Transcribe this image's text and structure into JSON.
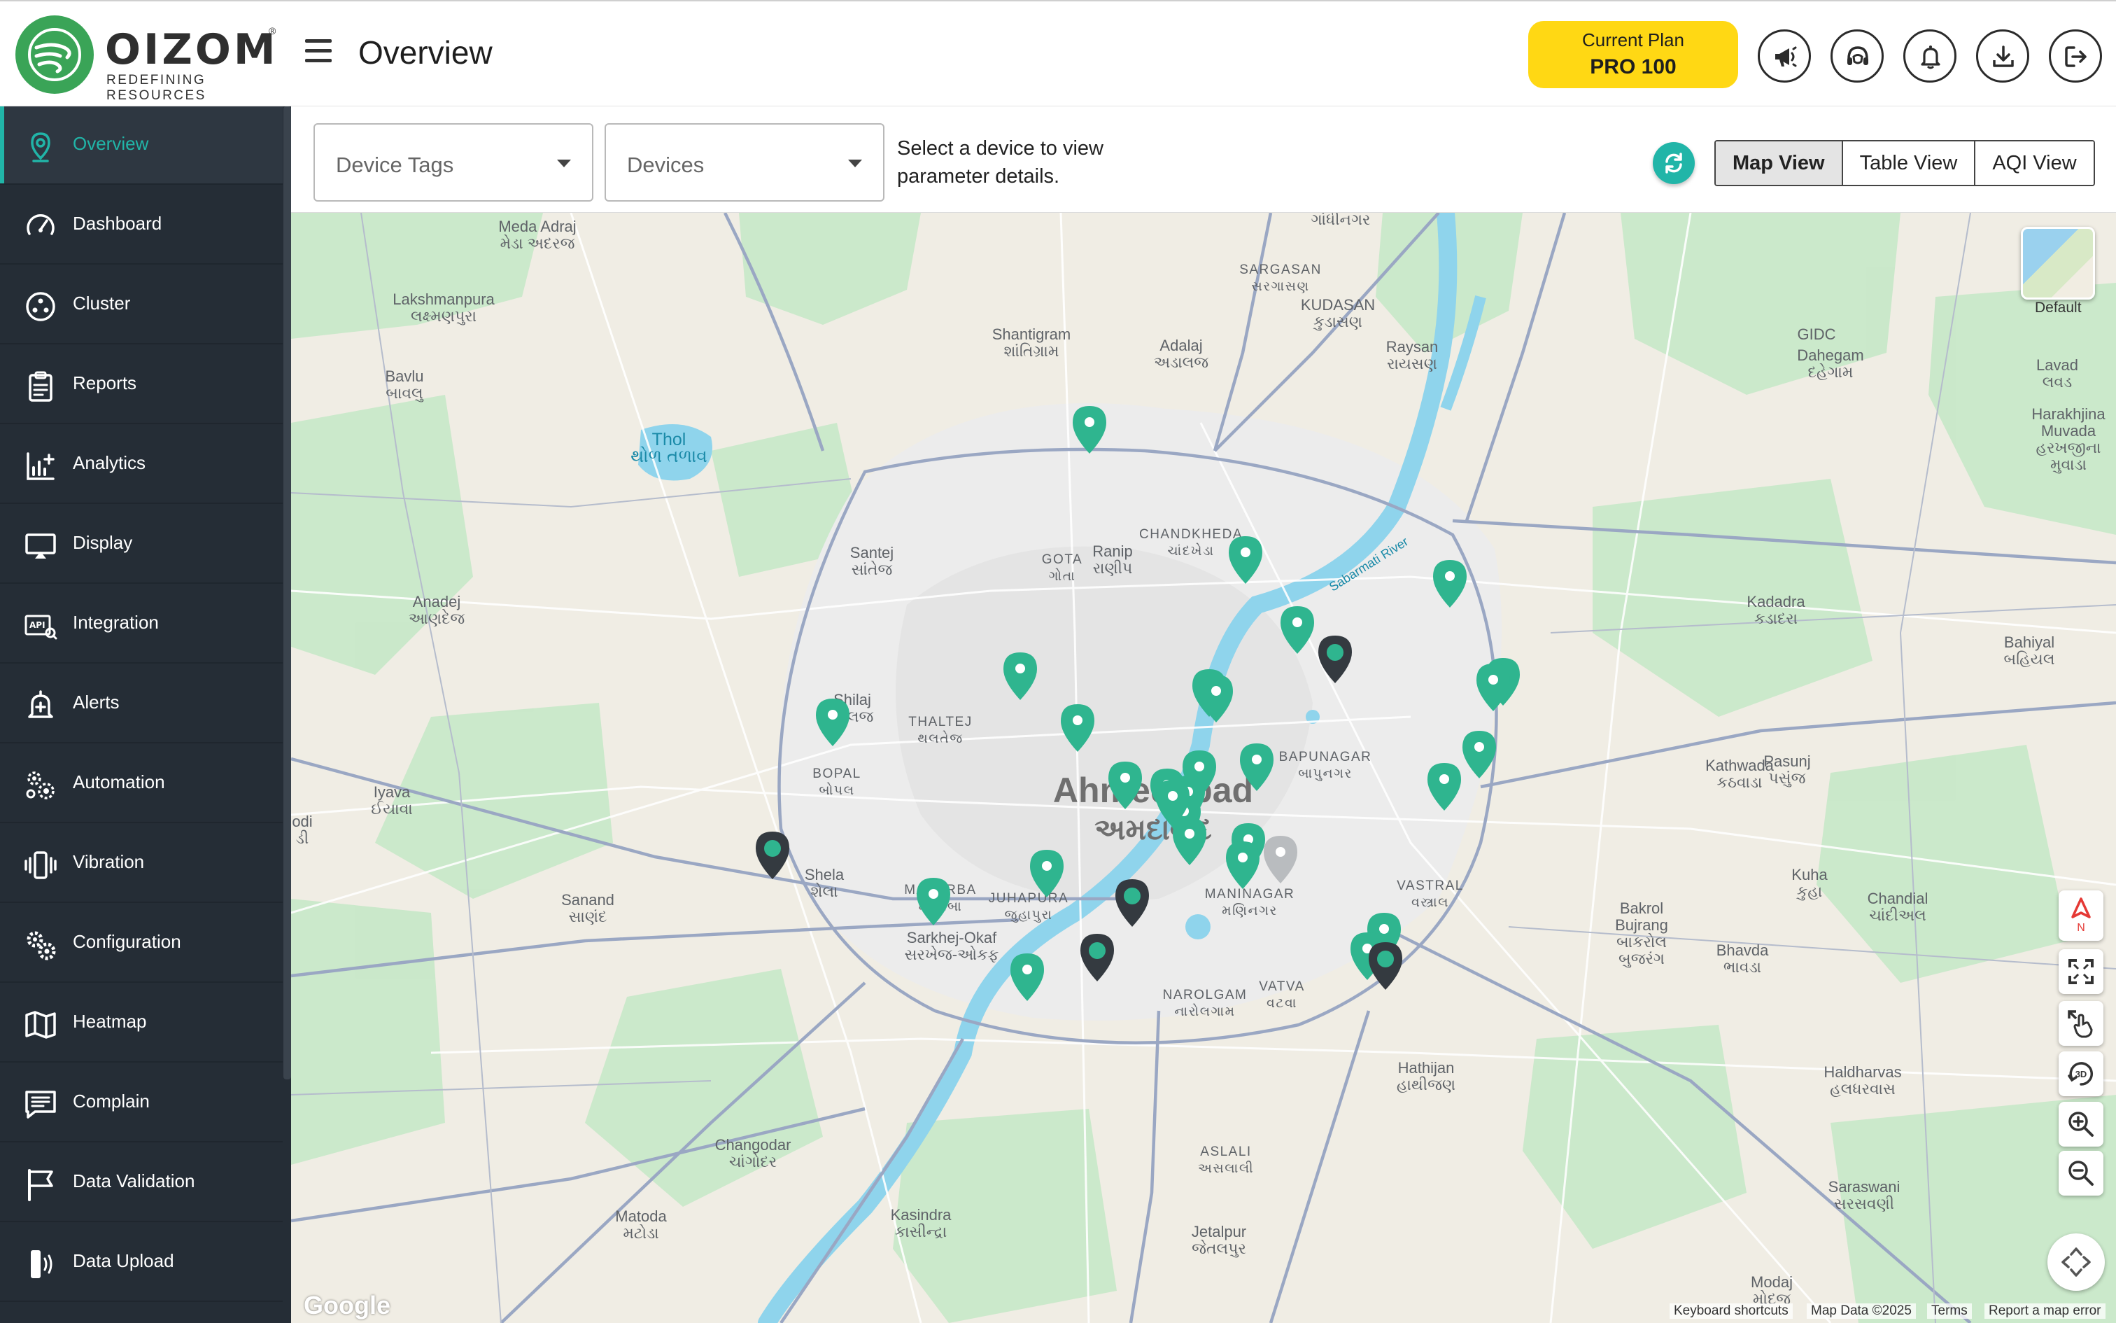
{
  "brand": {
    "name": "OIZOM",
    "tagline": "REDEFINING RESOURCES",
    "registered": "®",
    "color": "#3aa457"
  },
  "header": {
    "title": "Overview",
    "plan": {
      "label": "Current Plan",
      "value": "PRO 100",
      "color": "#ffd814"
    },
    "icons": [
      "megaphone-icon",
      "support-headset-icon",
      "bell-icon",
      "download-icon",
      "logout-icon"
    ]
  },
  "sidebar": {
    "accent": "#21b5a8",
    "items": [
      {
        "label": "Overview",
        "icon": "location-pin-icon",
        "active": true
      },
      {
        "label": "Dashboard",
        "icon": "gauge-icon"
      },
      {
        "label": "Cluster",
        "icon": "cluster-icon"
      },
      {
        "label": "Reports",
        "icon": "clipboard-icon"
      },
      {
        "label": "Analytics",
        "icon": "analytics-chart-icon"
      },
      {
        "label": "Display",
        "icon": "display-monitor-icon"
      },
      {
        "label": "Integration",
        "icon": "api-icon"
      },
      {
        "label": "Alerts",
        "icon": "alert-bell-icon"
      },
      {
        "label": "Automation",
        "icon": "automation-gears-icon"
      },
      {
        "label": "Vibration",
        "icon": "vibration-icon"
      },
      {
        "label": "Configuration",
        "icon": "gears-icon"
      },
      {
        "label": "Heatmap",
        "icon": "map-fold-icon"
      },
      {
        "label": "Complain",
        "icon": "comment-list-icon"
      },
      {
        "label": "Data Validation",
        "icon": "flag-icon"
      },
      {
        "label": "Data Upload",
        "icon": "upload-device-icon"
      }
    ]
  },
  "toolbar": {
    "device_tags": {
      "placeholder": "Device Tags"
    },
    "devices": {
      "placeholder": "Devices"
    },
    "hint": "Select a device to view parameter details.",
    "views": [
      {
        "label": "Map View",
        "active": true
      },
      {
        "label": "Table View",
        "active": false
      },
      {
        "label": "AQI View",
        "active": false
      }
    ]
  },
  "map": {
    "layer_label": "Default",
    "attribution": {
      "google": "Google",
      "shortcuts": "Keyboard shortcuts",
      "data": "Map Data ©2025",
      "terms": "Terms",
      "report": "Report a map error"
    },
    "compass": "N",
    "pin_colors": {
      "online": "#2fb58f",
      "offline": "#343a40",
      "inactive": "#b9bcbf"
    },
    "labels": [
      {
        "text": "Meda Adraj\nમેડા અદરજ"
      },
      {
        "text": "ગાંધીનગર"
      },
      {
        "text": "SARGASAN\nસરગાસણ"
      },
      {
        "text": "KUDASAN\nકુડાસણ"
      },
      {
        "text": "Raysan\nરાયસણ"
      },
      {
        "text": "GIDC"
      },
      {
        "text": "Dahegam\nદહેગામ"
      },
      {
        "text": "Lakshmanpura\nલક્ષ્મણપુરા"
      },
      {
        "text": "Bavlu\nબાવલુ"
      },
      {
        "text": "Shantigram\nશાંતિગ્રામ"
      },
      {
        "text": "Adalaj\nઅડાલજ"
      },
      {
        "text": "Lavad\nલવડ"
      },
      {
        "text": "Harakhjina\nMuvada\nહરખજીના\nમુવાડા"
      },
      {
        "text": "Thol\nથોળ તળાવ"
      },
      {
        "text": "CHANDKHEDA\nચાંદખેડા"
      },
      {
        "text": "Ranip\nરાણીપ"
      },
      {
        "text": "GOTA\nગોતા"
      },
      {
        "text": "Santej\nસાંતેજ"
      },
      {
        "text": "Sabarmati River"
      },
      {
        "text": "Anadej\nઆણદેજ"
      },
      {
        "text": "Kadadra\nકડાદરા"
      },
      {
        "text": "Bahiyal\nબહિયલ"
      },
      {
        "text": "Shilaj\nશીલજ"
      },
      {
        "text": "THALTEJ\nથલતેજ"
      },
      {
        "text": "Ahmedabad"
      },
      {
        "text": "અમદાવાદ"
      },
      {
        "text": "BAPUNAGAR\nબાપુનગર"
      },
      {
        "text": "Kathwada\nકઠવાડા"
      },
      {
        "text": "Pasunj\nપસુંજ"
      },
      {
        "text": "Iyava\nઈયાવા"
      },
      {
        "text": "BOPAL\nબોપલ"
      },
      {
        "text": "Shela\nશેલા"
      },
      {
        "text": "Sanand\nસાણંદ"
      },
      {
        "text": "MAKARBA\nમકરબા"
      },
      {
        "text": "JUHAPURA\nજુહાપુરા"
      },
      {
        "text": "MANINAGAR\nમણિનગર"
      },
      {
        "text": "VASTRAL\nવસ્ત્રાલ"
      },
      {
        "text": "Kuha\nકુહા"
      },
      {
        "text": "Chandial\nચાંદીઅલ"
      },
      {
        "text": "Bakrol\nBujrang\nબાકરોલ\nબુજરંગ"
      },
      {
        "text": "Bhavda\nભાવડા"
      },
      {
        "text": "Sarkhej-Okaf\nસરખેજ-ઓકફ"
      },
      {
        "text": "NAROLGAM\nનારોલગામ"
      },
      {
        "text": "VATVA\nવટવા"
      },
      {
        "text": "Hathijan\nહાથીજણ"
      },
      {
        "text": "Changodar\nચાંગોદર"
      },
      {
        "text": "ASLALI\nઅસલાલી"
      },
      {
        "text": "Matoda\nમટોડા"
      },
      {
        "text": "Kasindra\nકાસીન્દ્રા"
      },
      {
        "text": "Jetalpur\nજેતલપુર"
      },
      {
        "text": "Haldharvas\nહલધરવાસ"
      },
      {
        "text": "Saraswani\nસરસવણી"
      },
      {
        "text": "Modaj\nમોદજ"
      },
      {
        "text": "odi\nડી"
      }
    ]
  }
}
